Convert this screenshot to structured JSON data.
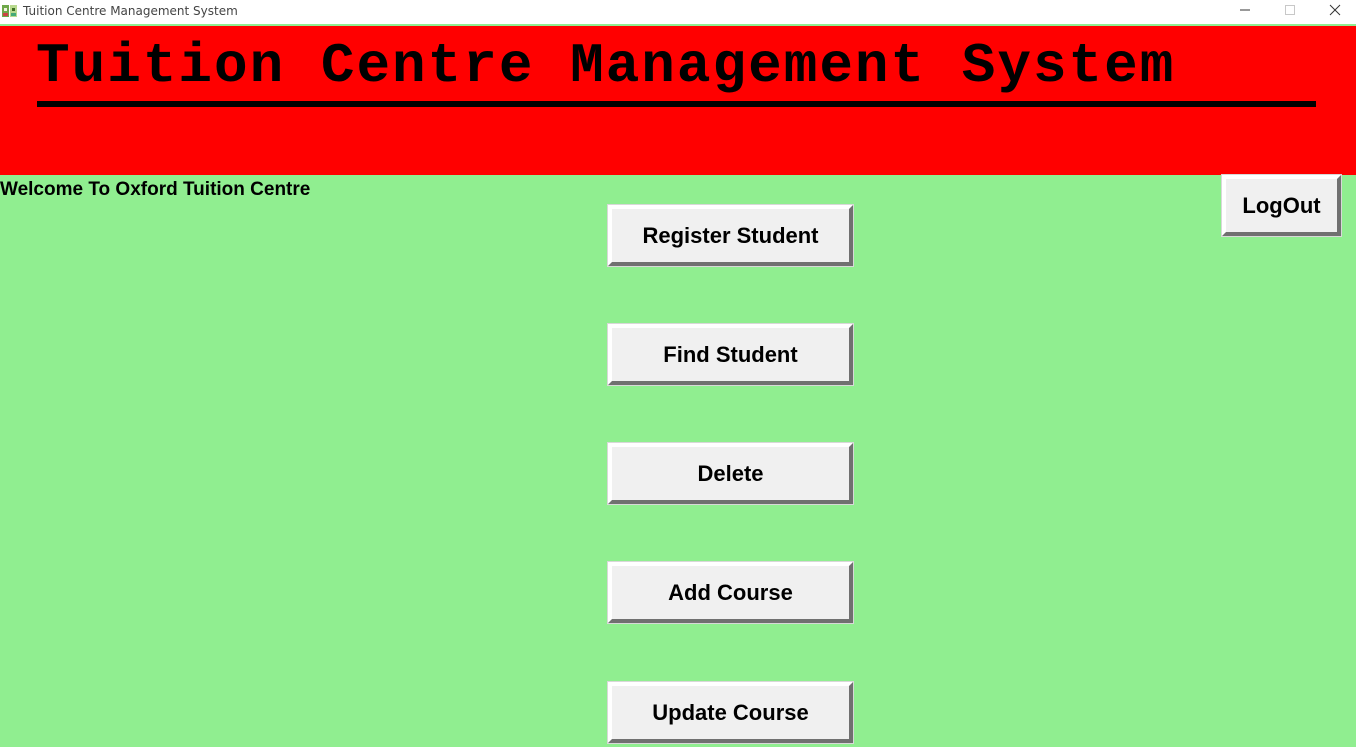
{
  "window": {
    "title": "Tuition Centre Management System",
    "controls": {
      "minimize_icon": "minimize-icon",
      "maximize_icon": "maximize-icon",
      "close_icon": "close-icon"
    }
  },
  "header": {
    "title": "Tuition Centre Management System",
    "background": "#FF0000"
  },
  "main": {
    "welcome_text": "Welcome To Oxford Tuition Centre",
    "background": "#90EE90",
    "buttons": {
      "register_student": "Register Student",
      "find_student": "Find Student",
      "delete": "Delete",
      "add_course": "Add Course",
      "update_course": "Update Course"
    },
    "logout_label": "LogOut"
  }
}
